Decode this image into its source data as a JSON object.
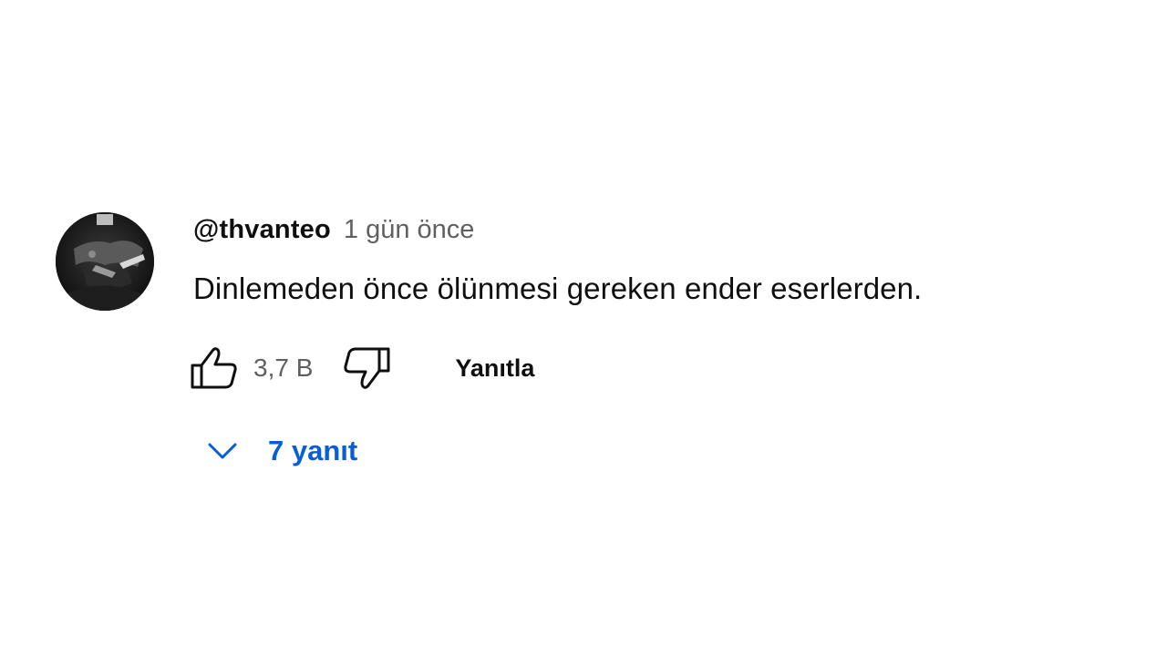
{
  "comment": {
    "author": "@thvanteo",
    "timestamp": "1 gün önce",
    "text": "Dinlemeden önce ölünmesi gereken ender eserlerden.",
    "avatar_icon": "user-avatar-photo",
    "likes": "3,7 B",
    "reply_label": "Yanıtla",
    "replies_label": "7 yanıt"
  },
  "icons": {
    "like": "thumbs-up-icon",
    "dislike": "thumbs-down-icon",
    "expand": "chevron-down-icon"
  },
  "colors": {
    "author": "#0f0f0f",
    "meta": "#606060",
    "link": "#065fd4",
    "background": "#ffffff"
  }
}
